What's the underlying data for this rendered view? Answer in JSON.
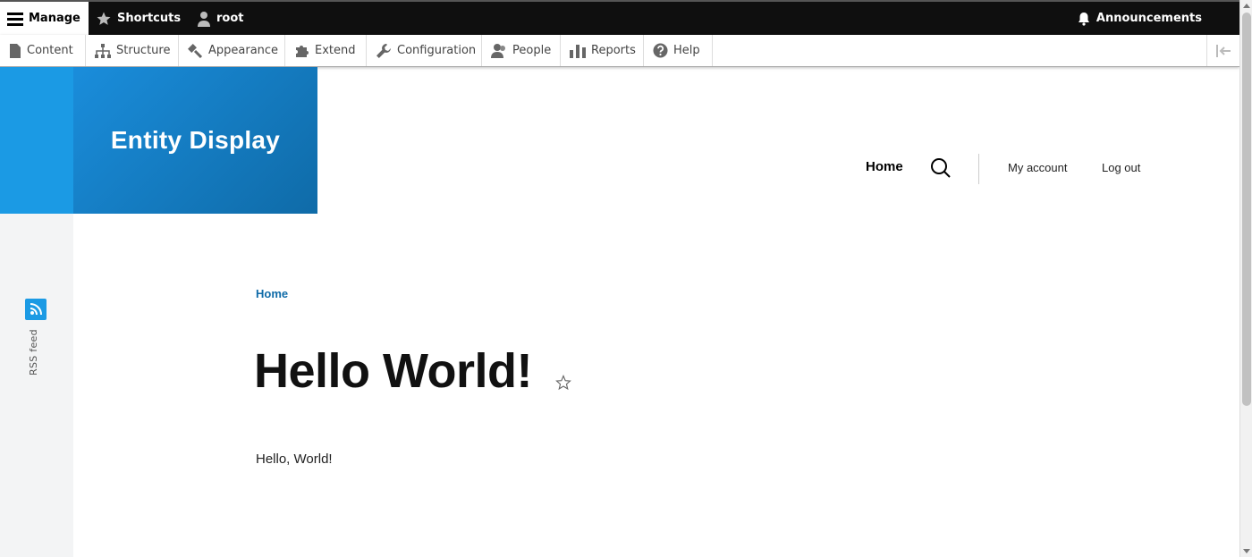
{
  "toolbar": {
    "manage": "Manage",
    "shortcuts": "Shortcuts",
    "user": "root",
    "announcements": "Announcements"
  },
  "tray": {
    "items": [
      "Content",
      "Structure",
      "Appearance",
      "Extend",
      "Configuration",
      "People",
      "Reports",
      "Help"
    ]
  },
  "site": {
    "name": "Entity Display"
  },
  "nav": {
    "home": "Home",
    "my_account": "My account",
    "logout": "Log out"
  },
  "sidebar": {
    "rss_label": "RSS feed"
  },
  "page": {
    "breadcrumb": "Home",
    "title": "Hello World!",
    "body": "Hello, World!"
  },
  "colors": {
    "brand_blue": "#1b9ae4",
    "brand_dark": "#0f6ba8",
    "toolbar_black": "#0f0f0f"
  },
  "icons": [
    "hamburger-icon",
    "star-icon",
    "user-icon",
    "bell-icon",
    "content-icon",
    "structure-icon",
    "appearance-icon",
    "extend-icon",
    "configuration-icon",
    "people-icon",
    "reports-icon",
    "help-icon",
    "collapse-icon",
    "search-icon",
    "rss-icon",
    "bookmark-star-icon"
  ]
}
